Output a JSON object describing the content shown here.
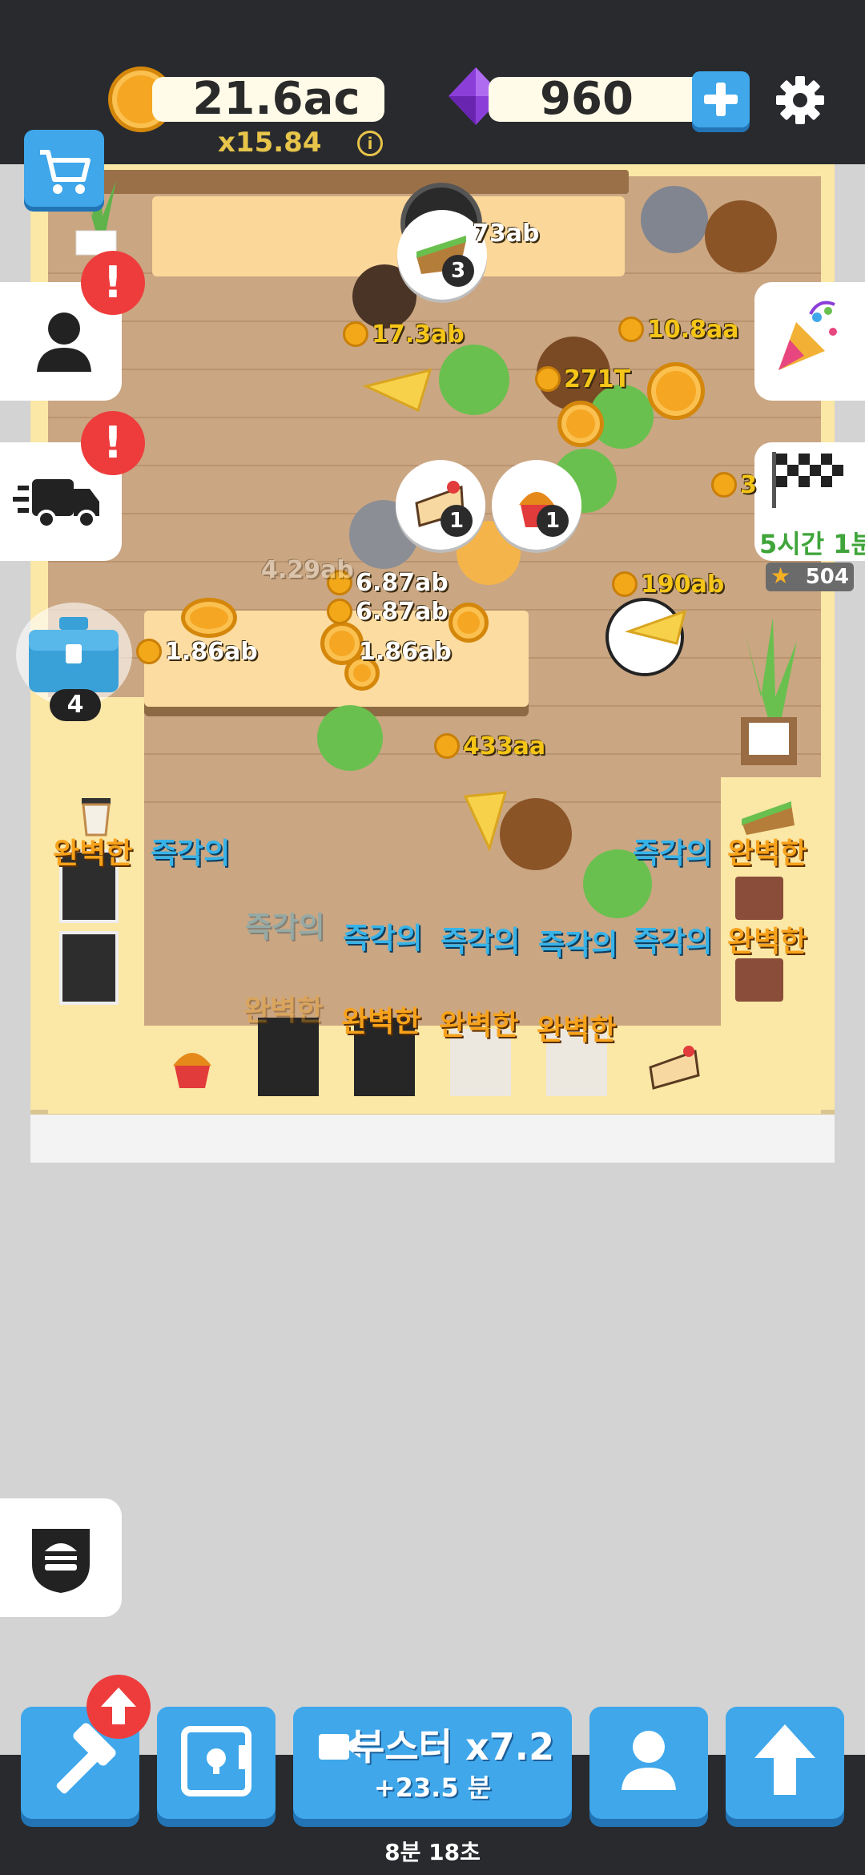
{
  "hud": {
    "coins": "21.6ac",
    "multiplier": "x15.84",
    "info_icon": "info-icon",
    "gems": "960",
    "add_icon": "plus-icon",
    "settings_icon": "gear-icon"
  },
  "side": {
    "shop_icon": "cart-icon",
    "manager_alert": "!",
    "delivery_alert": "!",
    "chest_count": "4",
    "event_timer": "5시간 1분",
    "event_stars": "504"
  },
  "floor_labels": {
    "money": [
      "73ab",
      "17.3ab",
      "10.8aa",
      "271T",
      "3",
      "6.87ab",
      "6.87ab",
      "1.86ab",
      "1.86ab",
      "190ab",
      "433aa",
      "4.29ab"
    ],
    "order_counts": [
      "3",
      "1",
      "1"
    ]
  },
  "station_labels": {
    "perfect": "완벽한",
    "instant": "즉각의"
  },
  "bottom": {
    "booster_label": "부스터 x7.2",
    "booster_sub": "+23.5 분",
    "timer": "8분 18초"
  },
  "colors": {
    "topbar": "#282a2e",
    "button_blue": "#3fa7ea",
    "alert_red": "#ee3c3c",
    "gold_text": "#f5c518"
  }
}
